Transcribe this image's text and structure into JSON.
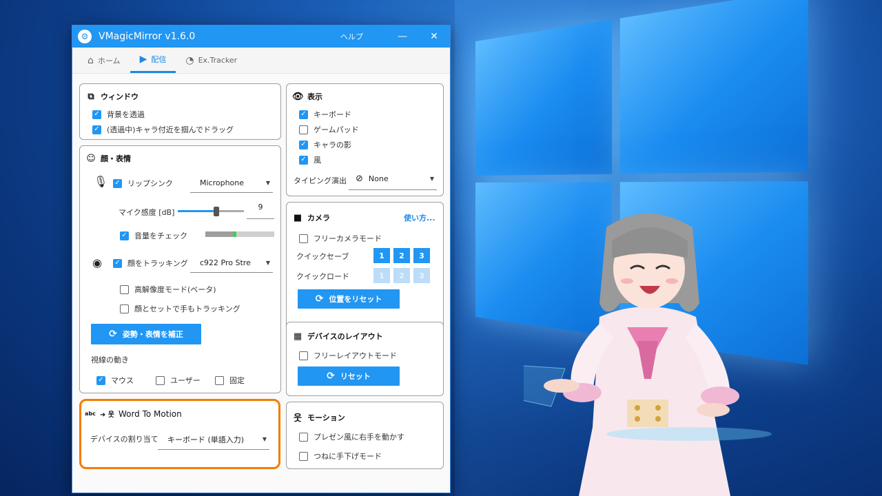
{
  "window": {
    "title": "VMagicMirror v1.6.0",
    "help": "ヘルプ",
    "minimize": "—",
    "close": "✕",
    "app_icon": "gear-icon"
  },
  "tabs": [
    {
      "label": "ホーム",
      "icon": "home-icon"
    },
    {
      "label": "配信",
      "icon": "camcorder-icon",
      "active": true
    },
    {
      "label": "Ex.Tracker",
      "icon": "tracker-icon"
    }
  ],
  "window_card": {
    "title": "ウィンドウ",
    "items": [
      {
        "label": "背景を透過",
        "checked": true
      },
      {
        "label": "(透過中)キャラ付近を掴んでドラッグ",
        "checked": true
      }
    ]
  },
  "face_card": {
    "title": "顔・表情",
    "lipsync": {
      "label": "リップシンク",
      "checked": true,
      "device": "Microphone"
    },
    "mic_sensitivity": {
      "label": "マイク感度 [dB]",
      "value": "9",
      "level": 0.6
    },
    "volume_check": {
      "label": "音量をチェック",
      "checked": true,
      "level": 0.45
    },
    "face_tracking": {
      "label": "顔をトラッキング",
      "checked": true,
      "device": "c922 Pro Stre"
    },
    "high_res": {
      "label": "高解像度モード(ベータ)",
      "checked": false
    },
    "hand_tracking": {
      "label": "顔とセットで手もトラッキング",
      "checked": false
    },
    "calibrate_button": "姿勢・表情を補正",
    "gaze": {
      "label": "視線の動き",
      "options": [
        {
          "label": "マウス",
          "checked": true
        },
        {
          "label": "ユーザー",
          "checked": false
        },
        {
          "label": "固定",
          "checked": false
        }
      ]
    }
  },
  "word_card": {
    "title": "Word To Motion",
    "device_label": "デバイスの割り当て",
    "device_value": "キーボード (単語入力)",
    "icon_text": "abc"
  },
  "display_card": {
    "title": "表示",
    "items": [
      {
        "label": "キーボード",
        "checked": true
      },
      {
        "label": "ゲームパッド",
        "checked": false
      },
      {
        "label": "キャラの影",
        "checked": true
      },
      {
        "label": "風",
        "checked": true
      }
    ],
    "typing_label": "タイピング演出",
    "typing_value": "None"
  },
  "camera_card": {
    "title": "カメラ",
    "help_link": "使い方...",
    "free_camera": {
      "label": "フリーカメラモード",
      "checked": false
    },
    "quick_save": "クイックセーブ",
    "quick_load": "クイックロード",
    "slots": [
      "1",
      "2",
      "3"
    ],
    "reset_button": "位置をリセット"
  },
  "layout_card": {
    "title": "デバイスのレイアウト",
    "free_layout": {
      "label": "フリーレイアウトモード",
      "checked": false
    },
    "reset_button": "リセット"
  },
  "motion_card": {
    "title": "モーション",
    "items": [
      {
        "label": "プレゼン風に右手を動かす",
        "checked": false
      },
      {
        "label": "つねに手下げモード",
        "checked": false
      }
    ]
  },
  "colors": {
    "accent": "#2196f3",
    "highlight": "#f57c00"
  }
}
